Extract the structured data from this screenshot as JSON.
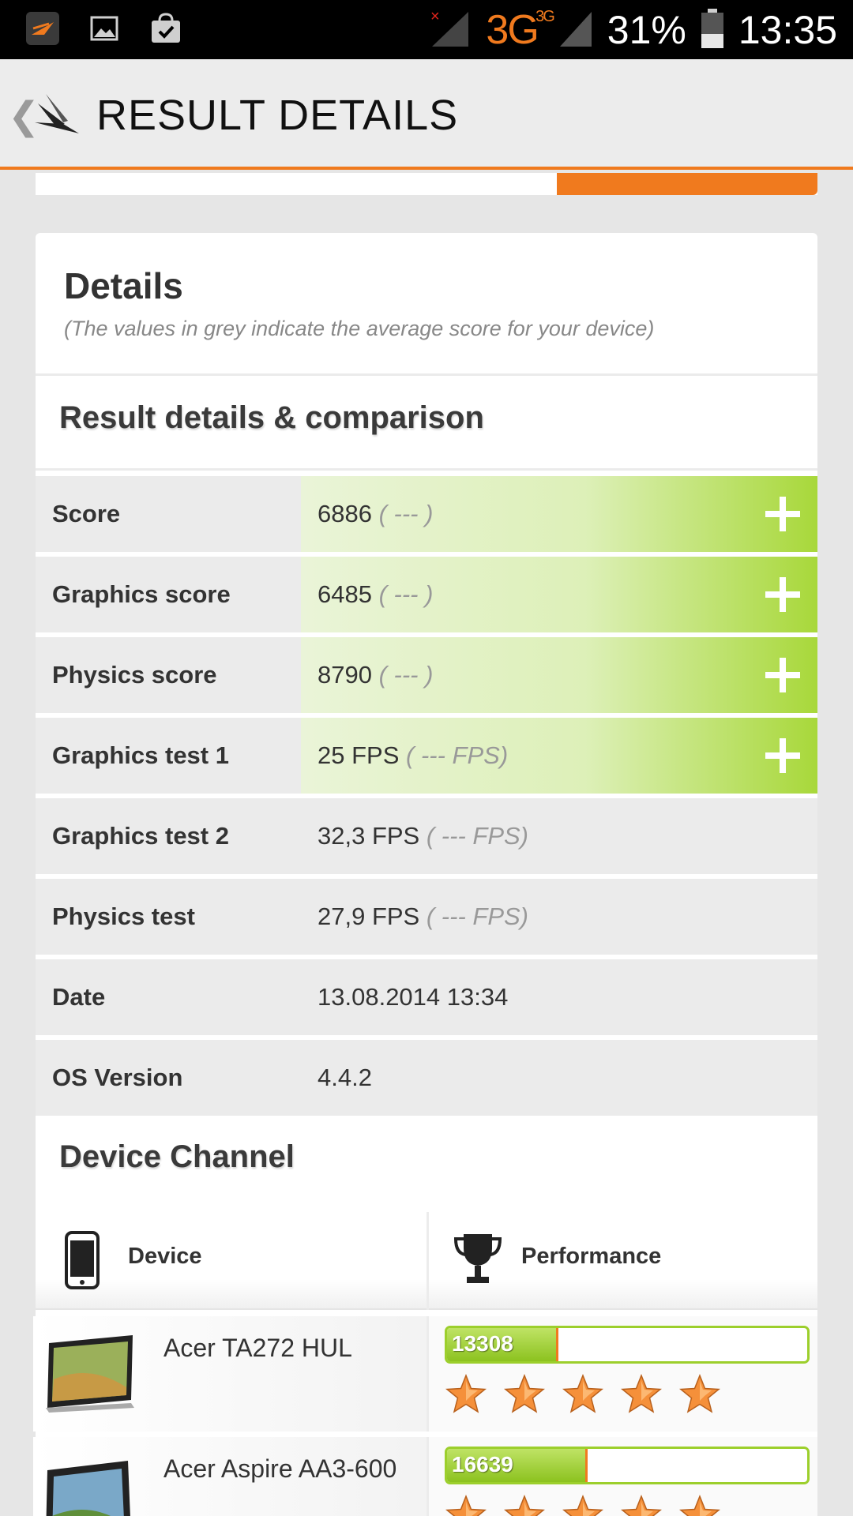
{
  "status_bar": {
    "network": "3G",
    "network_small": "3G",
    "battery": "31%",
    "time": "13:35",
    "icons": [
      "app-notification-icon",
      "gallery-icon",
      "shopping-bag-icon",
      "signal-icon",
      "battery-icon"
    ]
  },
  "app_bar": {
    "title": "RESULT DETAILS",
    "back_icon": "chevron-left-icon",
    "logo_icon": "3dmark-logo-icon"
  },
  "details": {
    "heading": "Details",
    "subtitle": "(The values in grey indicate the average score for your device)"
  },
  "comparison": {
    "heading": "Result details & comparison",
    "rows": [
      {
        "label": "Score",
        "value": "6886",
        "avg": "( --- )",
        "expandable": true
      },
      {
        "label": "Graphics score",
        "value": "6485",
        "avg": "( --- )",
        "expandable": true
      },
      {
        "label": "Physics score",
        "value": "8790",
        "avg": "( --- )",
        "expandable": true
      },
      {
        "label": "Graphics test 1",
        "value": "25 FPS",
        "avg": "( --- FPS)",
        "expandable": true
      },
      {
        "label": "Graphics test 2",
        "value": "32,3 FPS",
        "avg": "( --- FPS)",
        "expandable": false
      },
      {
        "label": "Physics test",
        "value": "27,9 FPS",
        "avg": "( --- FPS)",
        "expandable": false
      },
      {
        "label": "Date",
        "value": "13.08.2014 13:34",
        "avg": "",
        "expandable": false
      },
      {
        "label": "OS Version",
        "value": "4.4.2",
        "avg": "",
        "expandable": false
      }
    ]
  },
  "device_channel": {
    "heading": "Device Channel",
    "col_device": "Device",
    "col_performance": "Performance",
    "devices": [
      {
        "name": "Acer TA272 HUL",
        "score": "13308",
        "bar_fraction": 0.31,
        "stars": 5
      },
      {
        "name": "Acer Aspire AA3-600",
        "score": "16639",
        "bar_fraction": 0.39,
        "stars": 5
      }
    ]
  },
  "colors": {
    "accent": "#f07a1e",
    "highlight_green": "#a8d83a",
    "star_orange": "#f5903a"
  }
}
